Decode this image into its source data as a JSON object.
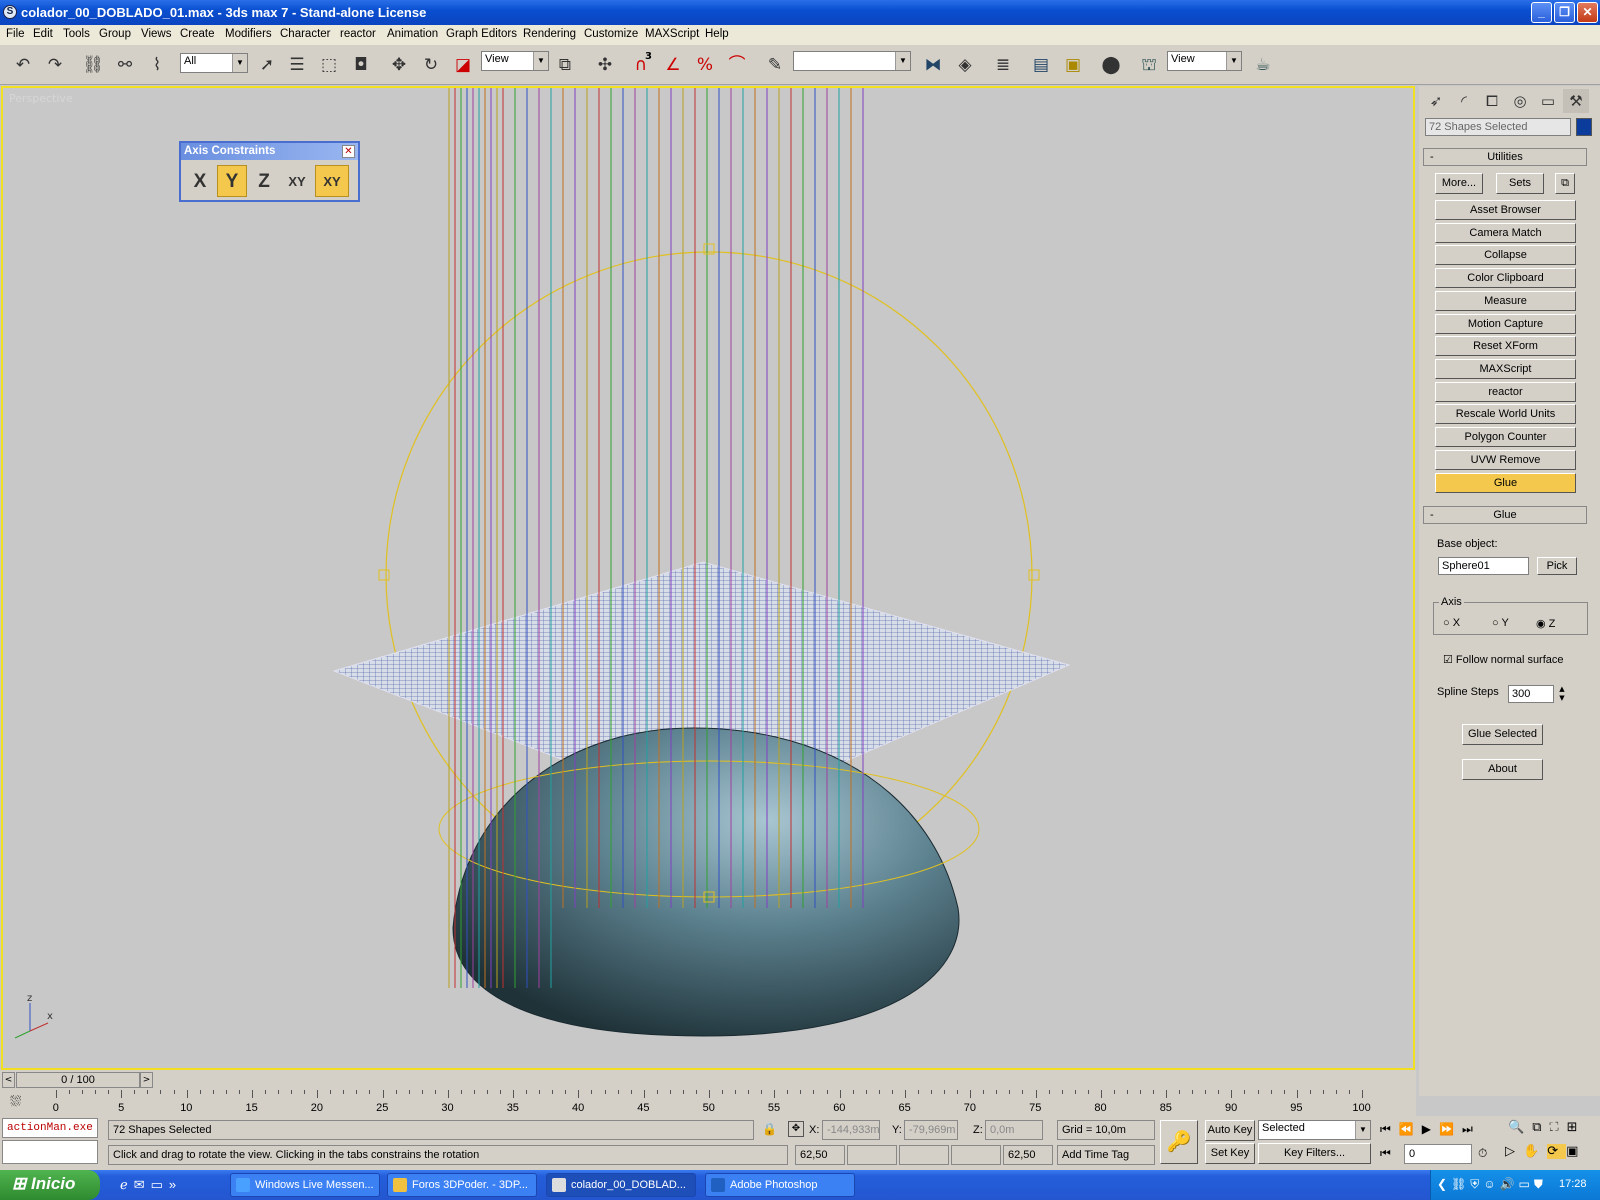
{
  "window": {
    "title": "colador_00_DOBLADO_01.max - 3ds max 7  - Stand-alone License",
    "app_icon": "3ds-max-icon",
    "controls": [
      "_",
      "❐",
      "✕"
    ]
  },
  "menu": [
    "File",
    "Edit",
    "Tools",
    "Group",
    "Views",
    "Create",
    "Modifiers",
    "Character",
    "reactor",
    "Animation",
    "Graph Editors",
    "Rendering",
    "Customize",
    "MAXScript",
    "Help"
  ],
  "toolbar": {
    "selection_filter": "All",
    "ref_coord_1": "View",
    "named_selection": "",
    "ref_coord_2": "View",
    "snap_label": "3"
  },
  "viewport": {
    "label": "Perspective",
    "gizmo_z": "z",
    "gizmo_x": "x"
  },
  "axis_constraints": {
    "title": "Axis Constraints",
    "buttons": [
      "X",
      "Y",
      "Z",
      "XY",
      "XY"
    ],
    "active": "Y"
  },
  "command_panel": {
    "selection_name": "72 Shapes Selected",
    "selection_color": "#0b3c9c",
    "utilities_rollout": "Utilities",
    "more_label": "More...",
    "sets_label": "Sets",
    "utilities": [
      "Asset Browser",
      "Camera Match",
      "Collapse",
      "Color Clipboard",
      "Measure",
      "Motion Capture",
      "Reset XForm",
      "MAXScript",
      "reactor",
      "Rescale World Units",
      "Polygon Counter",
      "UVW Remove",
      "Glue"
    ],
    "active_utility": "Glue",
    "glue_rollout": "Glue",
    "base_object_label": "Base object:",
    "base_object_value": "Sphere01",
    "pick_label": "Pick",
    "axis_group_label": "Axis",
    "axis_options": [
      "X",
      "Y",
      "Z"
    ],
    "axis_selected": "Z",
    "follow_normal_label": "Follow normal surface",
    "follow_normal_checked": true,
    "spline_steps_label": "Spline Steps",
    "spline_steps_value": "300",
    "glue_selected_label": "Glue Selected",
    "about_label": "About"
  },
  "timeline": {
    "frame_display": "0 / 100",
    "ticks": [
      "0",
      "5",
      "10",
      "15",
      "20",
      "25",
      "30",
      "35",
      "40",
      "45",
      "50",
      "55",
      "60",
      "65",
      "70",
      "75",
      "80",
      "85",
      "90",
      "95",
      "100"
    ]
  },
  "status": {
    "maxscript_listener": "actionMan.exe",
    "selection_info": "72 Shapes Selected",
    "prompt": "Click and drag to rotate the view.  Clicking in the tabs constrains the rotation",
    "x_label": "X:",
    "x_value": "-144,933m",
    "y_label": "Y:",
    "y_value": "-79,969m",
    "z_label": "Z:",
    "z_value": "0,0m",
    "grid": "Grid = 10,0m",
    "field_a": "62,50",
    "field_b": "62,50",
    "add_time_tag": "Add Time Tag",
    "auto_key": "Auto Key",
    "set_key": "Set Key",
    "key_mode": "Selected",
    "key_filters": "Key Filters...",
    "current_frame": "0"
  },
  "taskbar": {
    "start_label": "Inicio",
    "tasks": [
      {
        "label": "Windows Live Messen...",
        "icon_color": "#4aa0ff"
      },
      {
        "label": "Foros 3DPoder. - 3DP...",
        "icon_color": "#f0c040"
      },
      {
        "label": "colador_00_DOBLAD...",
        "icon_color": "#dddddd"
      },
      {
        "label": "Adobe Photoshop",
        "icon_color": "#2060c0"
      }
    ],
    "active_task": 2,
    "clock": "17:28"
  }
}
